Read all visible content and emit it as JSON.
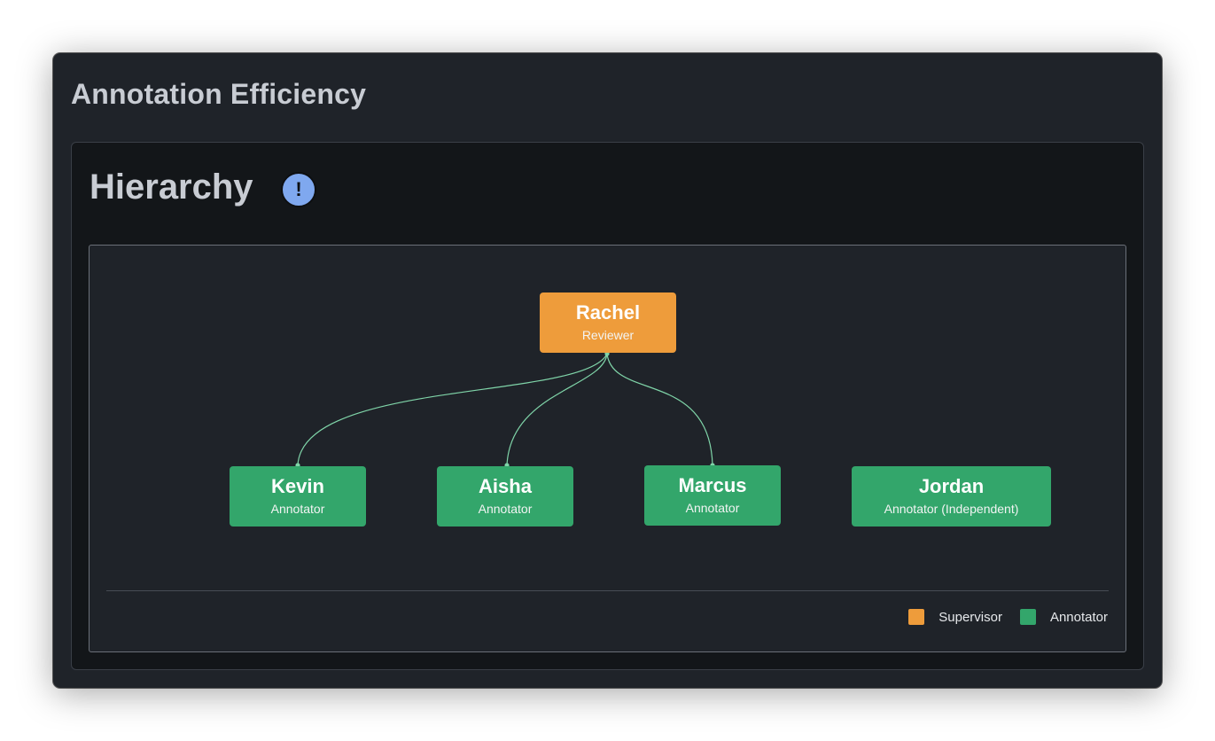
{
  "app": {
    "title": "Annotation Efficiency"
  },
  "panel": {
    "title": "Hierarchy",
    "alert_icon": "exclamation-circle-icon",
    "alert_glyph": "!"
  },
  "colors": {
    "supervisor": "#ee9c3b",
    "annotator": "#33a66b",
    "connector": "#7fd4a8",
    "background": "#1f2329",
    "alert": "#7fa8ef"
  },
  "hierarchy": {
    "root": {
      "name": "Rachel",
      "role": "Reviewer",
      "type": "supervisor"
    },
    "children": [
      {
        "name": "Kevin",
        "role": "Annotator",
        "type": "annotator",
        "reports_to": "Rachel"
      },
      {
        "name": "Aisha",
        "role": "Annotator",
        "type": "annotator",
        "reports_to": "Rachel"
      },
      {
        "name": "Marcus",
        "role": "Annotator",
        "type": "annotator",
        "reports_to": "Rachel"
      },
      {
        "name": "Jordan",
        "role": "Annotator (Independent)",
        "type": "annotator",
        "reports_to": null
      }
    ]
  },
  "legend": [
    {
      "label": "Supervisor",
      "color": "#ee9c3b"
    },
    {
      "label": "Annotator",
      "color": "#33a66b"
    }
  ]
}
